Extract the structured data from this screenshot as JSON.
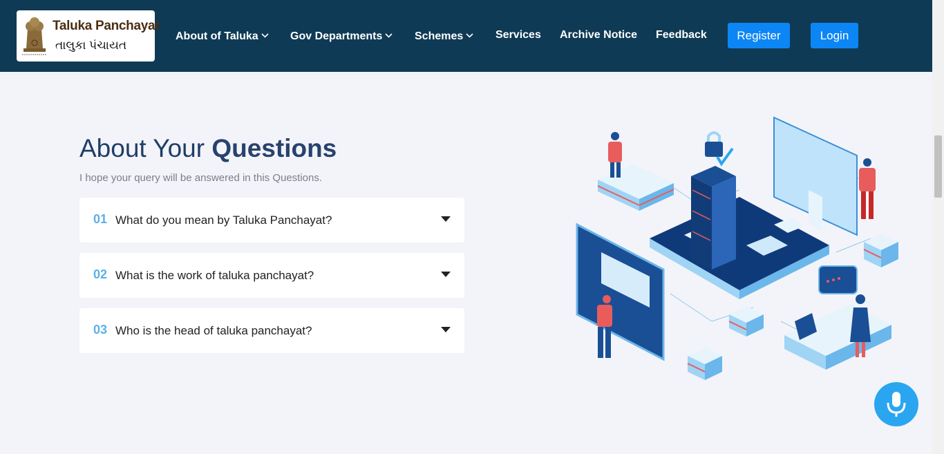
{
  "header": {
    "logo": {
      "title_en": "Taluka Panchayat",
      "title_gu": "તાલુકા પંચાયત",
      "emblem_text": "सत्यमेव जयते"
    },
    "nav": [
      {
        "label": "About of Taluka",
        "has_dropdown": true
      },
      {
        "label": "Gov Departments",
        "has_dropdown": true
      },
      {
        "label": "Schemes",
        "has_dropdown": true
      },
      {
        "label": "Services",
        "has_dropdown": false
      },
      {
        "label": "Archive Notice",
        "has_dropdown": false
      },
      {
        "label": "Feedback",
        "has_dropdown": false
      }
    ],
    "register_label": "Register",
    "login_label": "Login"
  },
  "faq_section": {
    "title_light": "About Your ",
    "title_bold": "Questions",
    "subtitle": "I hope your query will be answered in this Questions.",
    "items": [
      {
        "number": "01",
        "question": "What do you mean by Taluka Panchayat?"
      },
      {
        "number": "02",
        "question": "What is the work of taluka panchayat?"
      },
      {
        "number": "03",
        "question": "Who is the head of taluka panchayat?"
      }
    ]
  },
  "icons": {
    "dropdown": "chevron-down-icon",
    "faq_toggle": "caret-down-icon",
    "voice": "microphone-icon"
  },
  "colors": {
    "header_bg": "#0f3a55",
    "accent_blue": "#0d86f5",
    "number_blue": "#5cb0e6",
    "title_navy": "#1f3d66",
    "page_bg": "#f3f4f9",
    "mic_bg": "#2aa6f0"
  }
}
